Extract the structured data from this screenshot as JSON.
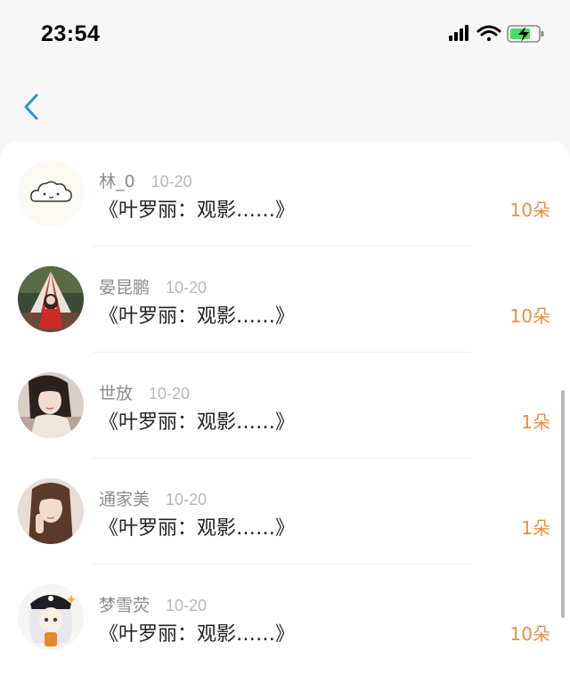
{
  "status_bar": {
    "time": "23:54",
    "icons": [
      "signal-icon",
      "wifi-icon",
      "battery-charging-icon"
    ],
    "battery_color": "#4cd964"
  },
  "nav": {
    "back_icon": "chevron-left-icon",
    "accent_color": "#2f8ff0"
  },
  "items": [
    {
      "name": "林_0",
      "date": "10-20",
      "title": "《叶罗丽：观影……》",
      "count": "10朵",
      "avatar": "cloud-avatar"
    },
    {
      "name": "晏昆鹏",
      "date": "10-20",
      "title": "《叶罗丽：观影……》",
      "count": "10朵",
      "avatar": "photo-avatar-tent"
    },
    {
      "name": "世放",
      "date": "10-20",
      "title": "《叶罗丽：观影……》",
      "count": "1朵",
      "avatar": "photo-avatar-girl"
    },
    {
      "name": "通家美",
      "date": "10-20",
      "title": "《叶罗丽：观影……》",
      "count": "1朵",
      "avatar": "photo-avatar-woman"
    },
    {
      "name": "梦雪荧",
      "date": "10-20",
      "title": "《叶罗丽：观影……》",
      "count": "10朵",
      "avatar": "anime-avatar"
    }
  ],
  "colors": {
    "count_text": "#e9913d",
    "name_text": "#8a8a8a",
    "date_text": "#b8b8b8"
  }
}
